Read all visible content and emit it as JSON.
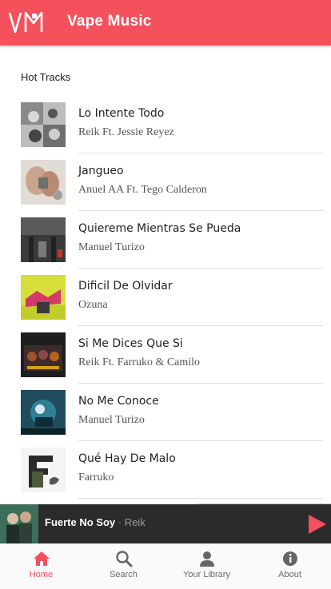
{
  "app": {
    "title": "Vape Music",
    "logo_text": "VM",
    "accent_color": "#f4515c"
  },
  "section": {
    "title": "Hot Tracks"
  },
  "tracks": [
    {
      "title": "Lo Intente Todo",
      "artist": "Reik Ft. Jessie Reyez"
    },
    {
      "title": "Jangueo",
      "artist": "Anuel AA Ft. Tego Calderon"
    },
    {
      "title": "Quiereme Mientras Se Pueda",
      "artist": "Manuel Turizo"
    },
    {
      "title": "Dificil De Olvidar",
      "artist": "Ozuna"
    },
    {
      "title": "Si Me Dices Que Si",
      "artist": "Reik Ft. Farruko & Camilo"
    },
    {
      "title": "No Me Conoce",
      "artist": "Manuel Turizo"
    },
    {
      "title": "Qué Hay De Malo",
      "artist": "Farruko"
    }
  ],
  "player": {
    "song": "Fuerte No Soy",
    "separator": " · ",
    "artist": "Reik",
    "play_icon": "play-icon"
  },
  "nav": {
    "items": [
      {
        "label": "Home",
        "icon": "home-icon",
        "active": true
      },
      {
        "label": "Search",
        "icon": "search-icon",
        "active": false
      },
      {
        "label": "Your Library",
        "icon": "user-icon",
        "active": false
      },
      {
        "label": "About",
        "icon": "info-icon",
        "active": false
      }
    ]
  }
}
